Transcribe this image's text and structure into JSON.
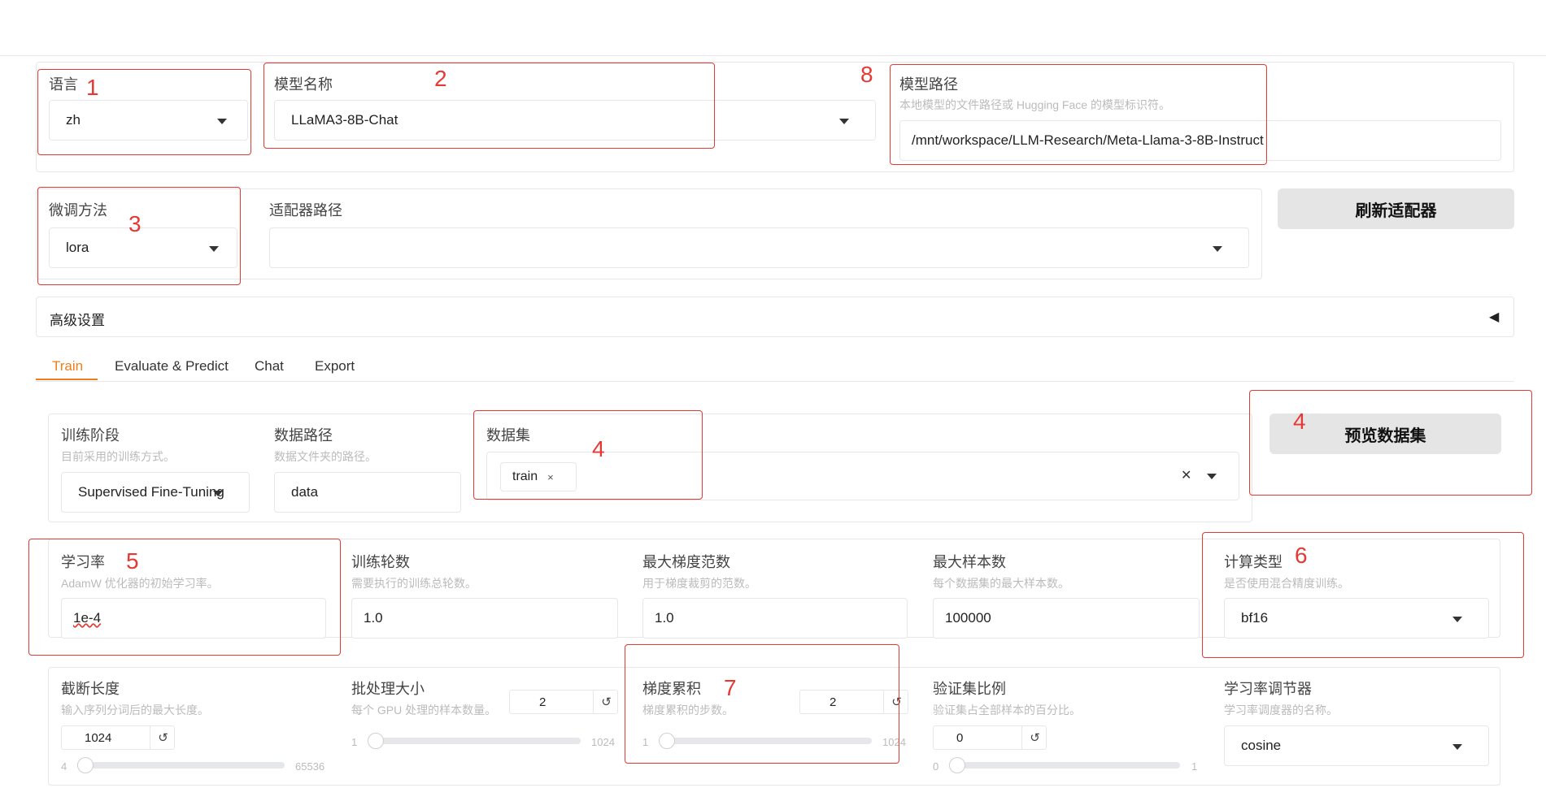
{
  "top": {
    "lang": {
      "label": "语言",
      "value": "zh"
    },
    "model_name": {
      "label": "模型名称",
      "value": "LLaMA3-8B-Chat"
    },
    "model_path": {
      "label": "模型路径",
      "hint": "本地模型的文件路径或 Hugging Face 的模型标识符。",
      "value": "/mnt/workspace/LLM-Research/Meta-Llama-3-8B-Instruct"
    },
    "finetune": {
      "label": "微调方法",
      "value": "lora"
    },
    "adapter": {
      "label": "适配器路径",
      "value": ""
    },
    "refresh_button": "刷新适配器",
    "advanced": "高级设置",
    "advanced_arrow": "◀"
  },
  "tabs": [
    "Train",
    "Evaluate & Predict",
    "Chat",
    "Export"
  ],
  "train": {
    "stage": {
      "label": "训练阶段",
      "hint": "目前采用的训练方式。",
      "value": "Supervised Fine-Tuning"
    },
    "data_dir": {
      "label": "数据路径",
      "hint": "数据文件夹的路径。",
      "value": "data"
    },
    "dataset": {
      "label": "数据集",
      "tag": "train",
      "tag_close": "×",
      "clear": "✕"
    },
    "preview_button": "预览数据集",
    "lr": {
      "label": "学习率",
      "hint": "AdamW 优化器的初始学习率。",
      "value": "1e-4"
    },
    "epochs": {
      "label": "训练轮数",
      "hint": "需要执行的训练总轮数。",
      "value": "1.0"
    },
    "max_grad": {
      "label": "最大梯度范数",
      "hint": "用于梯度裁剪的范数。",
      "value": "1.0"
    },
    "max_samples": {
      "label": "最大样本数",
      "hint": "每个数据集的最大样本数。",
      "value": "100000"
    },
    "compute": {
      "label": "计算类型",
      "hint": "是否使用混合精度训练。",
      "value": "bf16"
    },
    "cutoff": {
      "label": "截断长度",
      "hint": "输入序列分词后的最大长度。",
      "value": "1024",
      "min": "4",
      "max": "65536",
      "level": 0.015
    },
    "batch": {
      "label": "批处理大小",
      "hint": "每个 GPU 处理的样本数量。",
      "value": "2",
      "min": "1",
      "max": "1024",
      "level": 0.001
    },
    "grad_accum": {
      "label": "梯度累积",
      "hint": "梯度累积的步数。",
      "value": "2",
      "min": "1",
      "max": "1024",
      "level": 0.001
    },
    "val_size": {
      "label": "验证集比例",
      "hint": "验证集占全部样本的百分比。",
      "value": "0",
      "min": "0",
      "max": "1",
      "level": 0.0
    },
    "scheduler": {
      "label": "学习率调节器",
      "hint": "学习率调度器的名称。",
      "value": "cosine"
    },
    "reset_glyph": "↺"
  },
  "annotations": [
    "1",
    "2",
    "3",
    "4",
    "4",
    "5",
    "6",
    "7",
    "8"
  ],
  "colors": {
    "accent": "#f07d1a",
    "annotation": "#e53935",
    "border": "#e5e7eb"
  }
}
